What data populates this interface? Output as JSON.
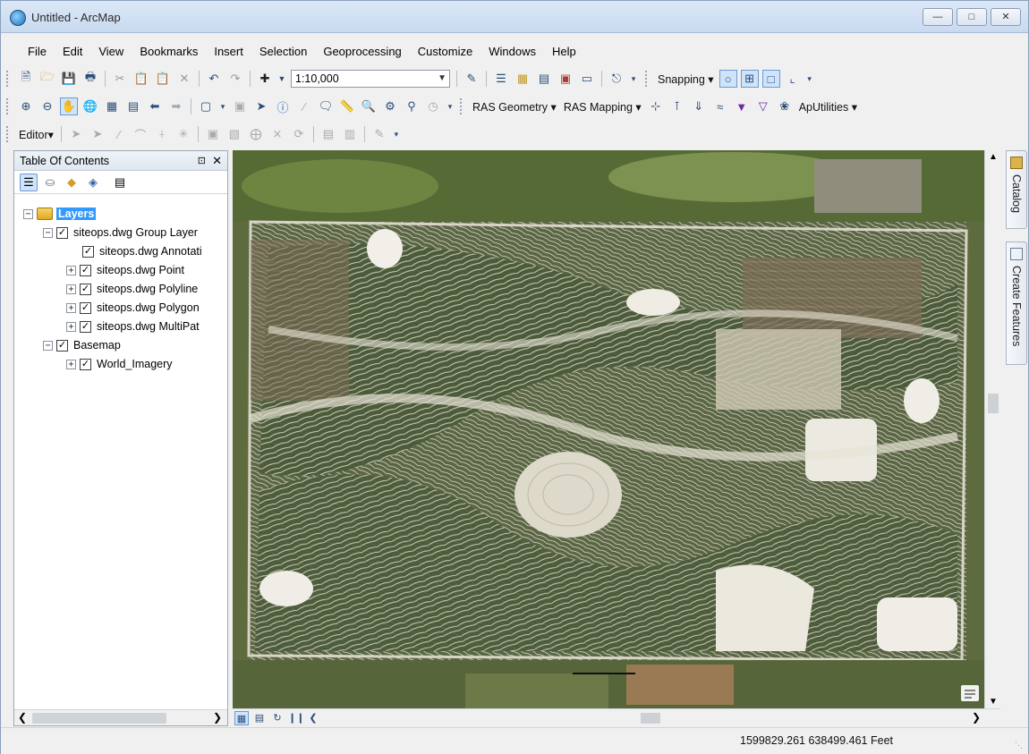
{
  "window": {
    "title": "Untitled - ArcMap",
    "controls": [
      "minimize",
      "maximize",
      "close"
    ]
  },
  "menu": [
    "File",
    "Edit",
    "View",
    "Bookmarks",
    "Insert",
    "Selection",
    "Geoprocessing",
    "Customize",
    "Windows",
    "Help"
  ],
  "toolbar1": {
    "scale_value": "1:10,000",
    "snapping_label": "Snapping"
  },
  "toolbar2": {
    "ras_geometry_label": "RAS Geometry",
    "ras_mapping_label": "RAS Mapping",
    "aputilities_label": "ApUtilities"
  },
  "toolbar3": {
    "editor_label": "Editor"
  },
  "toc": {
    "title": "Table Of Contents",
    "layers_root": "Layers",
    "items": [
      {
        "label": "siteops.dwg Group Layer",
        "checked": true,
        "expander": "minus"
      },
      {
        "label": "siteops.dwg Annotati",
        "checked": true,
        "expander": "none"
      },
      {
        "label": "siteops.dwg Point",
        "checked": true,
        "expander": "plus"
      },
      {
        "label": "siteops.dwg Polyline",
        "checked": true,
        "expander": "plus"
      },
      {
        "label": "siteops.dwg Polygon",
        "checked": true,
        "expander": "plus"
      },
      {
        "label": "siteops.dwg MultiPat",
        "checked": true,
        "expander": "plus"
      },
      {
        "label": "Basemap",
        "checked": true,
        "expander": "minus"
      },
      {
        "label": "World_Imagery",
        "checked": true,
        "expander": "plus"
      }
    ]
  },
  "side_dock": {
    "catalog_label": "Catalog",
    "create_features_label": "Create Features"
  },
  "status": {
    "coordinates": "1599829.261  638499.461 Feet"
  },
  "colors": {
    "selection": "#3399ff",
    "titlebar": "#dbe7f6",
    "map_background": "#4d5c35"
  }
}
